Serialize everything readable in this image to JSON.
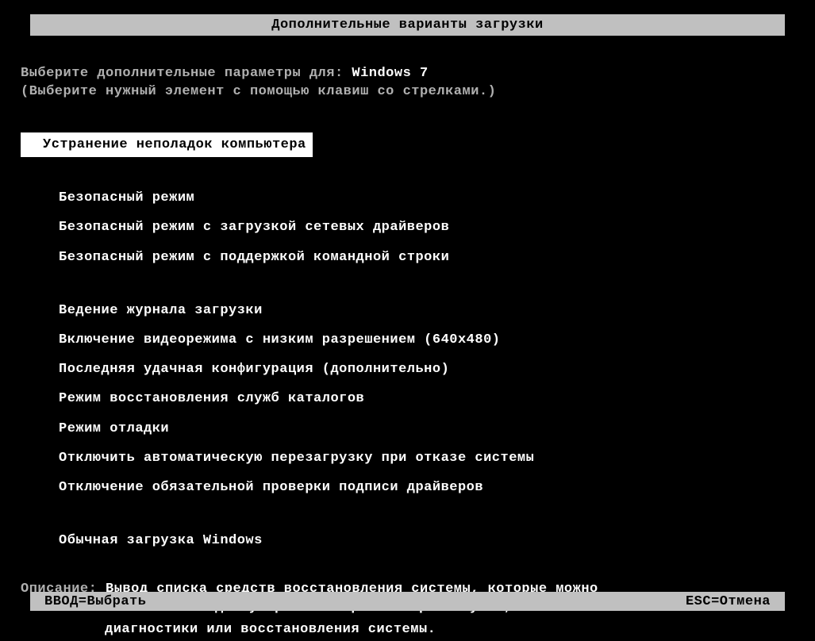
{
  "title": "Дополнительные варианты загрузки",
  "prompt": {
    "label": "Выберите дополнительные параметры для: ",
    "value": "Windows 7"
  },
  "instruction": "(Выберите нужный элемент с помощью клавиш со стрелками.)",
  "menu": {
    "blocks": [
      {
        "items": [
          {
            "label": "Устранение неполадок компьютера",
            "selected": true
          }
        ]
      },
      {
        "items": [
          {
            "label": "Безопасный режим",
            "selected": false
          },
          {
            "label": "Безопасный режим с загрузкой сетевых драйверов",
            "selected": false
          },
          {
            "label": "Безопасный режим с поддержкой командной строки",
            "selected": false
          }
        ]
      },
      {
        "items": [
          {
            "label": "Ведение журнала загрузки",
            "selected": false
          },
          {
            "label": "Включение видеорежима с низким разрешением (640x480)",
            "selected": false
          },
          {
            "label": "Последняя удачная конфигурация (дополнительно)",
            "selected": false
          },
          {
            "label": "Режим восстановления служб каталогов",
            "selected": false
          },
          {
            "label": "Режим отладки",
            "selected": false
          },
          {
            "label": "Отключить автоматическую перезагрузку при отказе системы",
            "selected": false
          },
          {
            "label": "Отключение обязательной проверки подписи драйверов",
            "selected": false
          }
        ]
      },
      {
        "items": [
          {
            "label": "Обычная загрузка Windows",
            "selected": false
          }
        ]
      }
    ]
  },
  "description": {
    "label": "Описание: ",
    "line1": "Вывод списка средств восстановления системы, которые можно",
    "line2": "использовать для устранения проблем при запуске, выполнения",
    "line3": "диагностики или восстановления системы."
  },
  "footer": {
    "enter": "ВВОД=Выбрать",
    "esc": "ESC=Отмена"
  }
}
